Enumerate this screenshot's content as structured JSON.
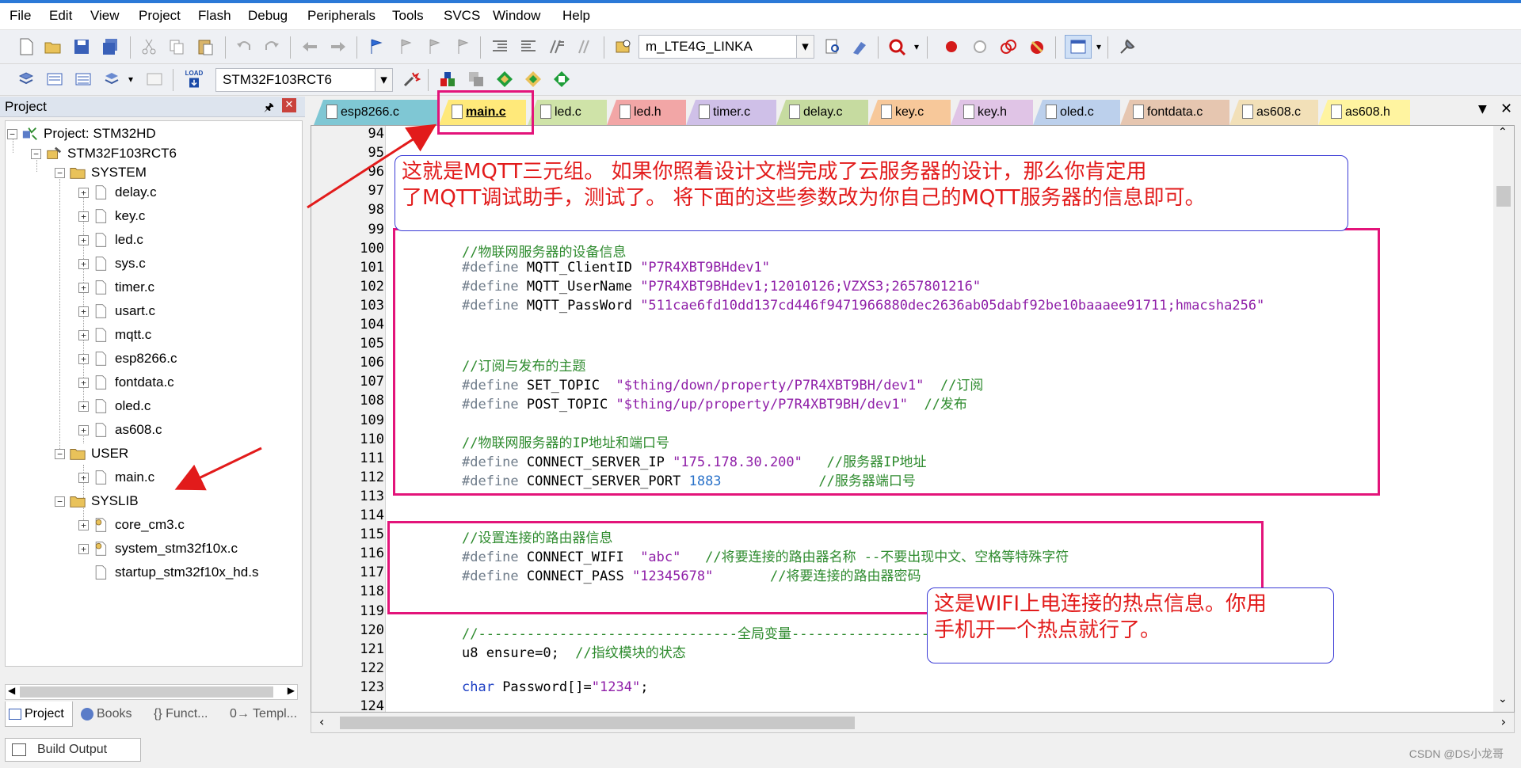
{
  "menu": [
    "File",
    "Edit",
    "View",
    "Project",
    "Flash",
    "Debug",
    "Peripherals",
    "Tools",
    "SVCS",
    "Window",
    "Help"
  ],
  "toolbar": {
    "target_combo": "m_LTE4G_LINKA",
    "device_combo": "STM32F103RCT6",
    "load_label": "LOAD"
  },
  "project_panel": {
    "title": "Project",
    "root": "Project: STM32HD",
    "target": "STM32F103RCT6",
    "groups": [
      {
        "name": "SYSTEM",
        "files": [
          "delay.c",
          "key.c",
          "led.c",
          "sys.c",
          "timer.c",
          "usart.c",
          "mqtt.c",
          "esp8266.c",
          "fontdata.c",
          "oled.c",
          "as608.c"
        ]
      },
      {
        "name": "USER",
        "files": [
          "main.c"
        ]
      },
      {
        "name": "SYSLIB",
        "files": [
          "core_cm3.c",
          "system_stm32f10x.c",
          "startup_stm32f10x_hd.s"
        ]
      }
    ],
    "tabs": [
      "Project",
      "Books",
      "{} Funct...",
      "0→ Templ..."
    ]
  },
  "editor_tabs": [
    {
      "label": "esp8266.c",
      "color": "#7fc7d4"
    },
    {
      "label": "main.c",
      "color": "#ffe97a"
    },
    {
      "label": "led.c",
      "color": "#cfe3a8"
    },
    {
      "label": "led.h",
      "color": "#f2a6a6"
    },
    {
      "label": "timer.c",
      "color": "#cfc0e8"
    },
    {
      "label": "delay.c",
      "color": "#c6dba0"
    },
    {
      "label": "key.c",
      "color": "#f7c89a"
    },
    {
      "label": "key.h",
      "color": "#e0c4e6"
    },
    {
      "label": "oled.c",
      "color": "#bcd0ec"
    },
    {
      "label": "fontdata.c",
      "color": "#e6c6b0"
    },
    {
      "label": "as608.c",
      "color": "#f2e0b8"
    },
    {
      "label": "as608.h",
      "color": "#fff4a0"
    }
  ],
  "code_lines": [
    {
      "n": "94",
      "t": []
    },
    {
      "n": "95",
      "t": []
    },
    {
      "n": "96",
      "t": []
    },
    {
      "n": "97",
      "t": []
    },
    {
      "n": "98",
      "t": []
    },
    {
      "n": "99",
      "t": []
    },
    {
      "n": "100",
      "t": [
        {
          "c": "com",
          "s": "//物联网服务器的设备信息"
        }
      ]
    },
    {
      "n": "101",
      "t": [
        {
          "c": "dir",
          "s": "#define "
        },
        {
          "c": "",
          "s": "MQTT_ClientID "
        },
        {
          "c": "str",
          "s": "\"P7R4XBT9BHdev1\""
        }
      ]
    },
    {
      "n": "102",
      "t": [
        {
          "c": "dir",
          "s": "#define "
        },
        {
          "c": "",
          "s": "MQTT_UserName "
        },
        {
          "c": "str",
          "s": "\"P7R4XBT9BHdev1;12010126;VZXS3;2657801216\""
        }
      ]
    },
    {
      "n": "103",
      "t": [
        {
          "c": "dir",
          "s": "#define "
        },
        {
          "c": "",
          "s": "MQTT_PassWord "
        },
        {
          "c": "str",
          "s": "\"511cae6fd10dd137cd446f9471966880dec2636ab05dabf92be10baaaee91711;hmacsha256\""
        }
      ]
    },
    {
      "n": "104",
      "t": []
    },
    {
      "n": "105",
      "t": []
    },
    {
      "n": "106",
      "t": [
        {
          "c": "com",
          "s": "//订阅与发布的主题"
        }
      ]
    },
    {
      "n": "107",
      "t": [
        {
          "c": "dir",
          "s": "#define "
        },
        {
          "c": "",
          "s": "SET_TOPIC  "
        },
        {
          "c": "str",
          "s": "\"$thing/down/property/P7R4XBT9BH/dev1\""
        },
        {
          "c": "",
          "s": "  "
        },
        {
          "c": "com",
          "s": "//订阅"
        }
      ]
    },
    {
      "n": "108",
      "t": [
        {
          "c": "dir",
          "s": "#define "
        },
        {
          "c": "",
          "s": "POST_TOPIC "
        },
        {
          "c": "str",
          "s": "\"$thing/up/property/P7R4XBT9BH/dev1\""
        },
        {
          "c": "",
          "s": "  "
        },
        {
          "c": "com",
          "s": "//发布"
        }
      ]
    },
    {
      "n": "109",
      "t": []
    },
    {
      "n": "110",
      "t": [
        {
          "c": "com",
          "s": "//物联网服务器的IP地址和端口号"
        }
      ]
    },
    {
      "n": "111",
      "t": [
        {
          "c": "dir",
          "s": "#define "
        },
        {
          "c": "",
          "s": "CONNECT_SERVER_IP "
        },
        {
          "c": "str",
          "s": "\"175.178.30.200\""
        },
        {
          "c": "",
          "s": "   "
        },
        {
          "c": "com",
          "s": "//服务器IP地址"
        }
      ]
    },
    {
      "n": "112",
      "t": [
        {
          "c": "dir",
          "s": "#define "
        },
        {
          "c": "",
          "s": "CONNECT_SERVER_PORT "
        },
        {
          "c": "num",
          "s": "1883"
        },
        {
          "c": "",
          "s": "            "
        },
        {
          "c": "com",
          "s": "//服务器端口号"
        }
      ]
    },
    {
      "n": "113",
      "t": []
    },
    {
      "n": "114",
      "t": []
    },
    {
      "n": "115",
      "t": [
        {
          "c": "com",
          "s": "//设置连接的路由器信息"
        }
      ]
    },
    {
      "n": "116",
      "t": [
        {
          "c": "dir",
          "s": "#define "
        },
        {
          "c": "",
          "s": "CONNECT_WIFI  "
        },
        {
          "c": "str",
          "s": "\"abc\""
        },
        {
          "c": "",
          "s": "   "
        },
        {
          "c": "com",
          "s": "//将要连接的路由器名称 --不要出现中文、空格等特殊字符"
        }
      ]
    },
    {
      "n": "117",
      "t": [
        {
          "c": "dir",
          "s": "#define "
        },
        {
          "c": "",
          "s": "CONNECT_PASS "
        },
        {
          "c": "str",
          "s": "\"12345678\""
        },
        {
          "c": "",
          "s": "       "
        },
        {
          "c": "com",
          "s": "//将要连接的路由器密码"
        }
      ]
    },
    {
      "n": "118",
      "t": []
    },
    {
      "n": "119",
      "t": []
    },
    {
      "n": "120",
      "t": [
        {
          "c": "com",
          "s": "//--------------------------------全局变量----------------------------------"
        }
      ]
    },
    {
      "n": "121",
      "t": [
        {
          "c": "",
          "s": "u8 ensure=0;  "
        },
        {
          "c": "com",
          "s": "//指纹模块的状态"
        }
      ]
    },
    {
      "n": "122",
      "t": []
    },
    {
      "n": "123",
      "t": [
        {
          "c": "kw",
          "s": "char "
        },
        {
          "c": "",
          "s": "Password[]="
        },
        {
          "c": "str",
          "s": "\"1234\""
        },
        {
          "c": "",
          "s": ";"
        }
      ]
    },
    {
      "n": "124",
      "t": []
    }
  ],
  "annotations": {
    "top_note": [
      "这就是MQTT三元组。 如果你照着设计文档完成了云服务器的设计，那么你肯定用",
      "了MQTT调试助手，测试了。 将下面的这些参数改为你自己的MQTT服务器的信息即可。"
    ],
    "wifi_note": [
      "这是WIFI上电连接的热点信息。你用",
      "手机开一个热点就行了。"
    ]
  },
  "bottom": {
    "build_output": "Build Output",
    "watermark": "CSDN @DS小龙哥"
  },
  "colors": {
    "accent": "#2b79d7",
    "annotation_red": "#e21b1b",
    "highlight_pink": "#e3147a"
  }
}
